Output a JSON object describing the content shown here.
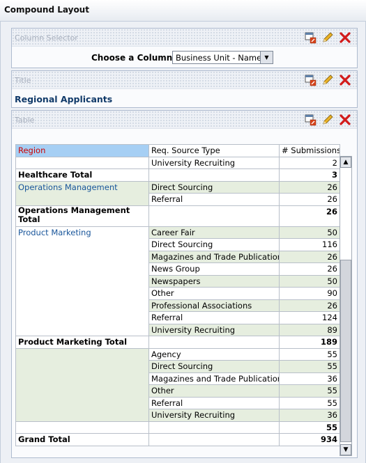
{
  "page": {
    "title": "Compound Layout"
  },
  "column_selector": {
    "section_title": "Column Selector",
    "label": "Choose a Column:",
    "selected": "Business Unit - Name"
  },
  "title_view": {
    "section_title": "Title",
    "heading": "Regional Applicants"
  },
  "table_view": {
    "section_title": "Table",
    "headers": {
      "region": "Region",
      "source": "Req. Source Type",
      "submissions": "# Submissions"
    },
    "rows": [
      {
        "region": "",
        "source": "University Recruiting",
        "value": "2"
      },
      {
        "region": "Healthcare Total",
        "source": "",
        "value": "3"
      },
      {
        "region": "Operations Management",
        "source": "Direct Sourcing",
        "value": "26"
      },
      {
        "region": "",
        "source": "Referral",
        "value": "26"
      },
      {
        "region": "Operations Management Total",
        "source": "",
        "value": "26"
      },
      {
        "region": "Product Marketing",
        "source": "Career Fair",
        "value": "50"
      },
      {
        "region": "",
        "source": "Direct Sourcing",
        "value": "116"
      },
      {
        "region": "",
        "source": "Magazines and Trade Publications",
        "value": "26"
      },
      {
        "region": "",
        "source": "News Group",
        "value": "26"
      },
      {
        "region": "",
        "source": "Newspapers",
        "value": "50"
      },
      {
        "region": "",
        "source": "Other",
        "value": "90"
      },
      {
        "region": "",
        "source": "Professional Associations",
        "value": "26"
      },
      {
        "region": "",
        "source": "Referral",
        "value": "124"
      },
      {
        "region": "",
        "source": "University Recruiting",
        "value": "89"
      },
      {
        "region": "Product Marketing Total",
        "source": "",
        "value": "189"
      },
      {
        "region": "",
        "source": "Agency",
        "value": "55"
      },
      {
        "region": "",
        "source": "Direct Sourcing",
        "value": "55"
      },
      {
        "region": "",
        "source": "Magazines and Trade Publications",
        "value": "36"
      },
      {
        "region": "",
        "source": "Other",
        "value": "55"
      },
      {
        "region": "",
        "source": "Referral",
        "value": "55"
      },
      {
        "region": "",
        "source": "University Recruiting",
        "value": "36"
      },
      {
        "region": "",
        "source": "",
        "value": "55"
      },
      {
        "region": "Grand Total",
        "source": "",
        "value": "934"
      }
    ]
  },
  "icons": [
    "properties-icon",
    "edit-pencil-icon",
    "delete-x-icon"
  ],
  "colors": {
    "region_header_bg": "#a6cff4",
    "region_header_text": "#cc0000",
    "region_link": "#18559a",
    "green_cell": "#e6eedf",
    "title_text": "#113a69"
  }
}
